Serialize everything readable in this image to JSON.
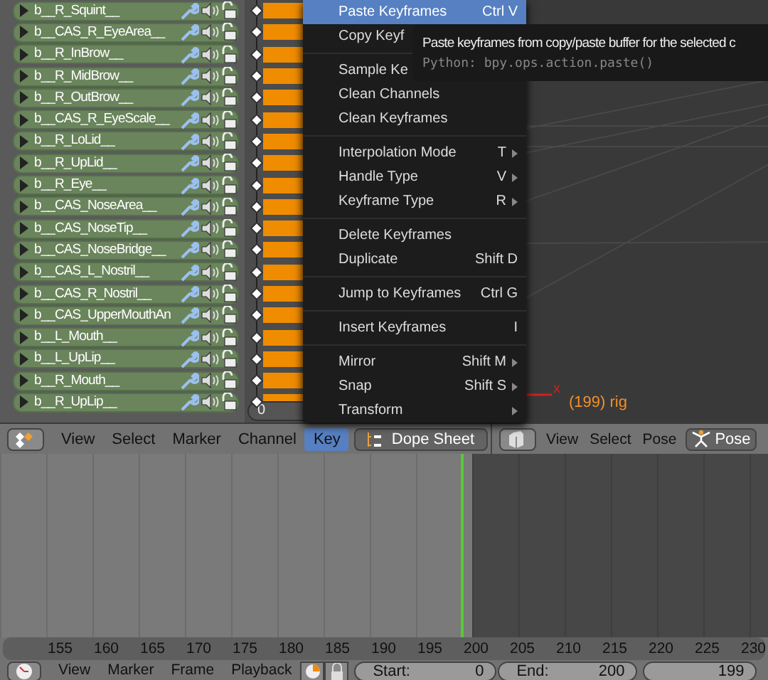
{
  "channels": [
    {
      "name": "b__R_Squint__"
    },
    {
      "name": "b__CAS_R_EyeArea__"
    },
    {
      "name": "b__R_InBrow__"
    },
    {
      "name": "b__R_MidBrow__"
    },
    {
      "name": "b__R_OutBrow__"
    },
    {
      "name": "b__CAS_R_EyeScale__"
    },
    {
      "name": "b__R_LoLid__"
    },
    {
      "name": "b__R_UpLid__"
    },
    {
      "name": "b__R_Eye__"
    },
    {
      "name": "b__CAS_NoseArea__"
    },
    {
      "name": "b__CAS_NoseTip__"
    },
    {
      "name": "b__CAS_NoseBridge__"
    },
    {
      "name": "b__CAS_L_Nostril__"
    },
    {
      "name": "b__CAS_R_Nostril__"
    },
    {
      "name": "b__CAS_UpperMouthAn"
    },
    {
      "name": "b__L_Mouth__"
    },
    {
      "name": "b__L_UpLip__"
    },
    {
      "name": "b__R_Mouth__"
    },
    {
      "name": "b__R_UpLip__"
    }
  ],
  "frame_field": "0",
  "menu": {
    "groups": [
      [
        {
          "label": "Paste Keyframes",
          "shortcut": "Ctrl V",
          "submenu": false,
          "selected": true
        },
        {
          "label": "Copy Keyf",
          "submenu": false,
          "selected": false
        }
      ],
      [
        {
          "label": "Sample Ke",
          "submenu": false,
          "selected": false
        },
        {
          "label": "Clean Channels",
          "submenu": false,
          "selected": false
        },
        {
          "label": "Clean Keyframes",
          "submenu": false,
          "selected": false
        }
      ],
      [
        {
          "label": "Interpolation Mode",
          "shortcut": "T",
          "submenu": true,
          "selected": false
        },
        {
          "label": "Handle Type",
          "shortcut": "V",
          "submenu": true,
          "selected": false
        },
        {
          "label": "Keyframe Type",
          "shortcut": "R",
          "submenu": true,
          "selected": false
        }
      ],
      [
        {
          "label": "Delete Keyframes",
          "submenu": false,
          "selected": false
        },
        {
          "label": "Duplicate",
          "shortcut": "Shift D",
          "submenu": false,
          "selected": false
        }
      ],
      [
        {
          "label": "Jump to Keyframes",
          "shortcut": "Ctrl G",
          "submenu": false,
          "selected": false
        }
      ],
      [
        {
          "label": "Insert Keyframes",
          "shortcut": "I",
          "submenu": false,
          "selected": false
        }
      ],
      [
        {
          "label": "Mirror",
          "shortcut": "Shift M",
          "submenu": true,
          "selected": false
        },
        {
          "label": "Snap",
          "shortcut": "Shift S",
          "submenu": true,
          "selected": false
        },
        {
          "label": "Transform",
          "submenu": true,
          "selected": false
        }
      ]
    ]
  },
  "tooltip": {
    "text": "Paste keyframes from copy/paste buffer for the selected c",
    "python": "Python: bpy.ops.action.paste()"
  },
  "viewport": {
    "axis_label": "x",
    "info": "(199) rig"
  },
  "dopesheet_header": {
    "menus": [
      {
        "label": "View",
        "selected": false
      },
      {
        "label": "Select",
        "selected": false
      },
      {
        "label": "Marker",
        "selected": false
      },
      {
        "label": "Channel",
        "selected": false
      },
      {
        "label": "Key",
        "selected": true
      }
    ],
    "mode": "Dope Sheet"
  },
  "viewport_header": {
    "menus": [
      "View",
      "Select",
      "Pose"
    ],
    "mode": "Pose"
  },
  "ruler": [
    "155",
    "160",
    "165",
    "170",
    "175",
    "180",
    "185",
    "190",
    "195",
    "200",
    "205",
    "210",
    "215",
    "220",
    "225",
    "230"
  ],
  "timeline_header": {
    "menus": [
      "View",
      "Marker",
      "Frame",
      "Playback"
    ],
    "start_label": "Start:",
    "start": "0",
    "end_label": "End:",
    "end": "200",
    "current": "199"
  }
}
